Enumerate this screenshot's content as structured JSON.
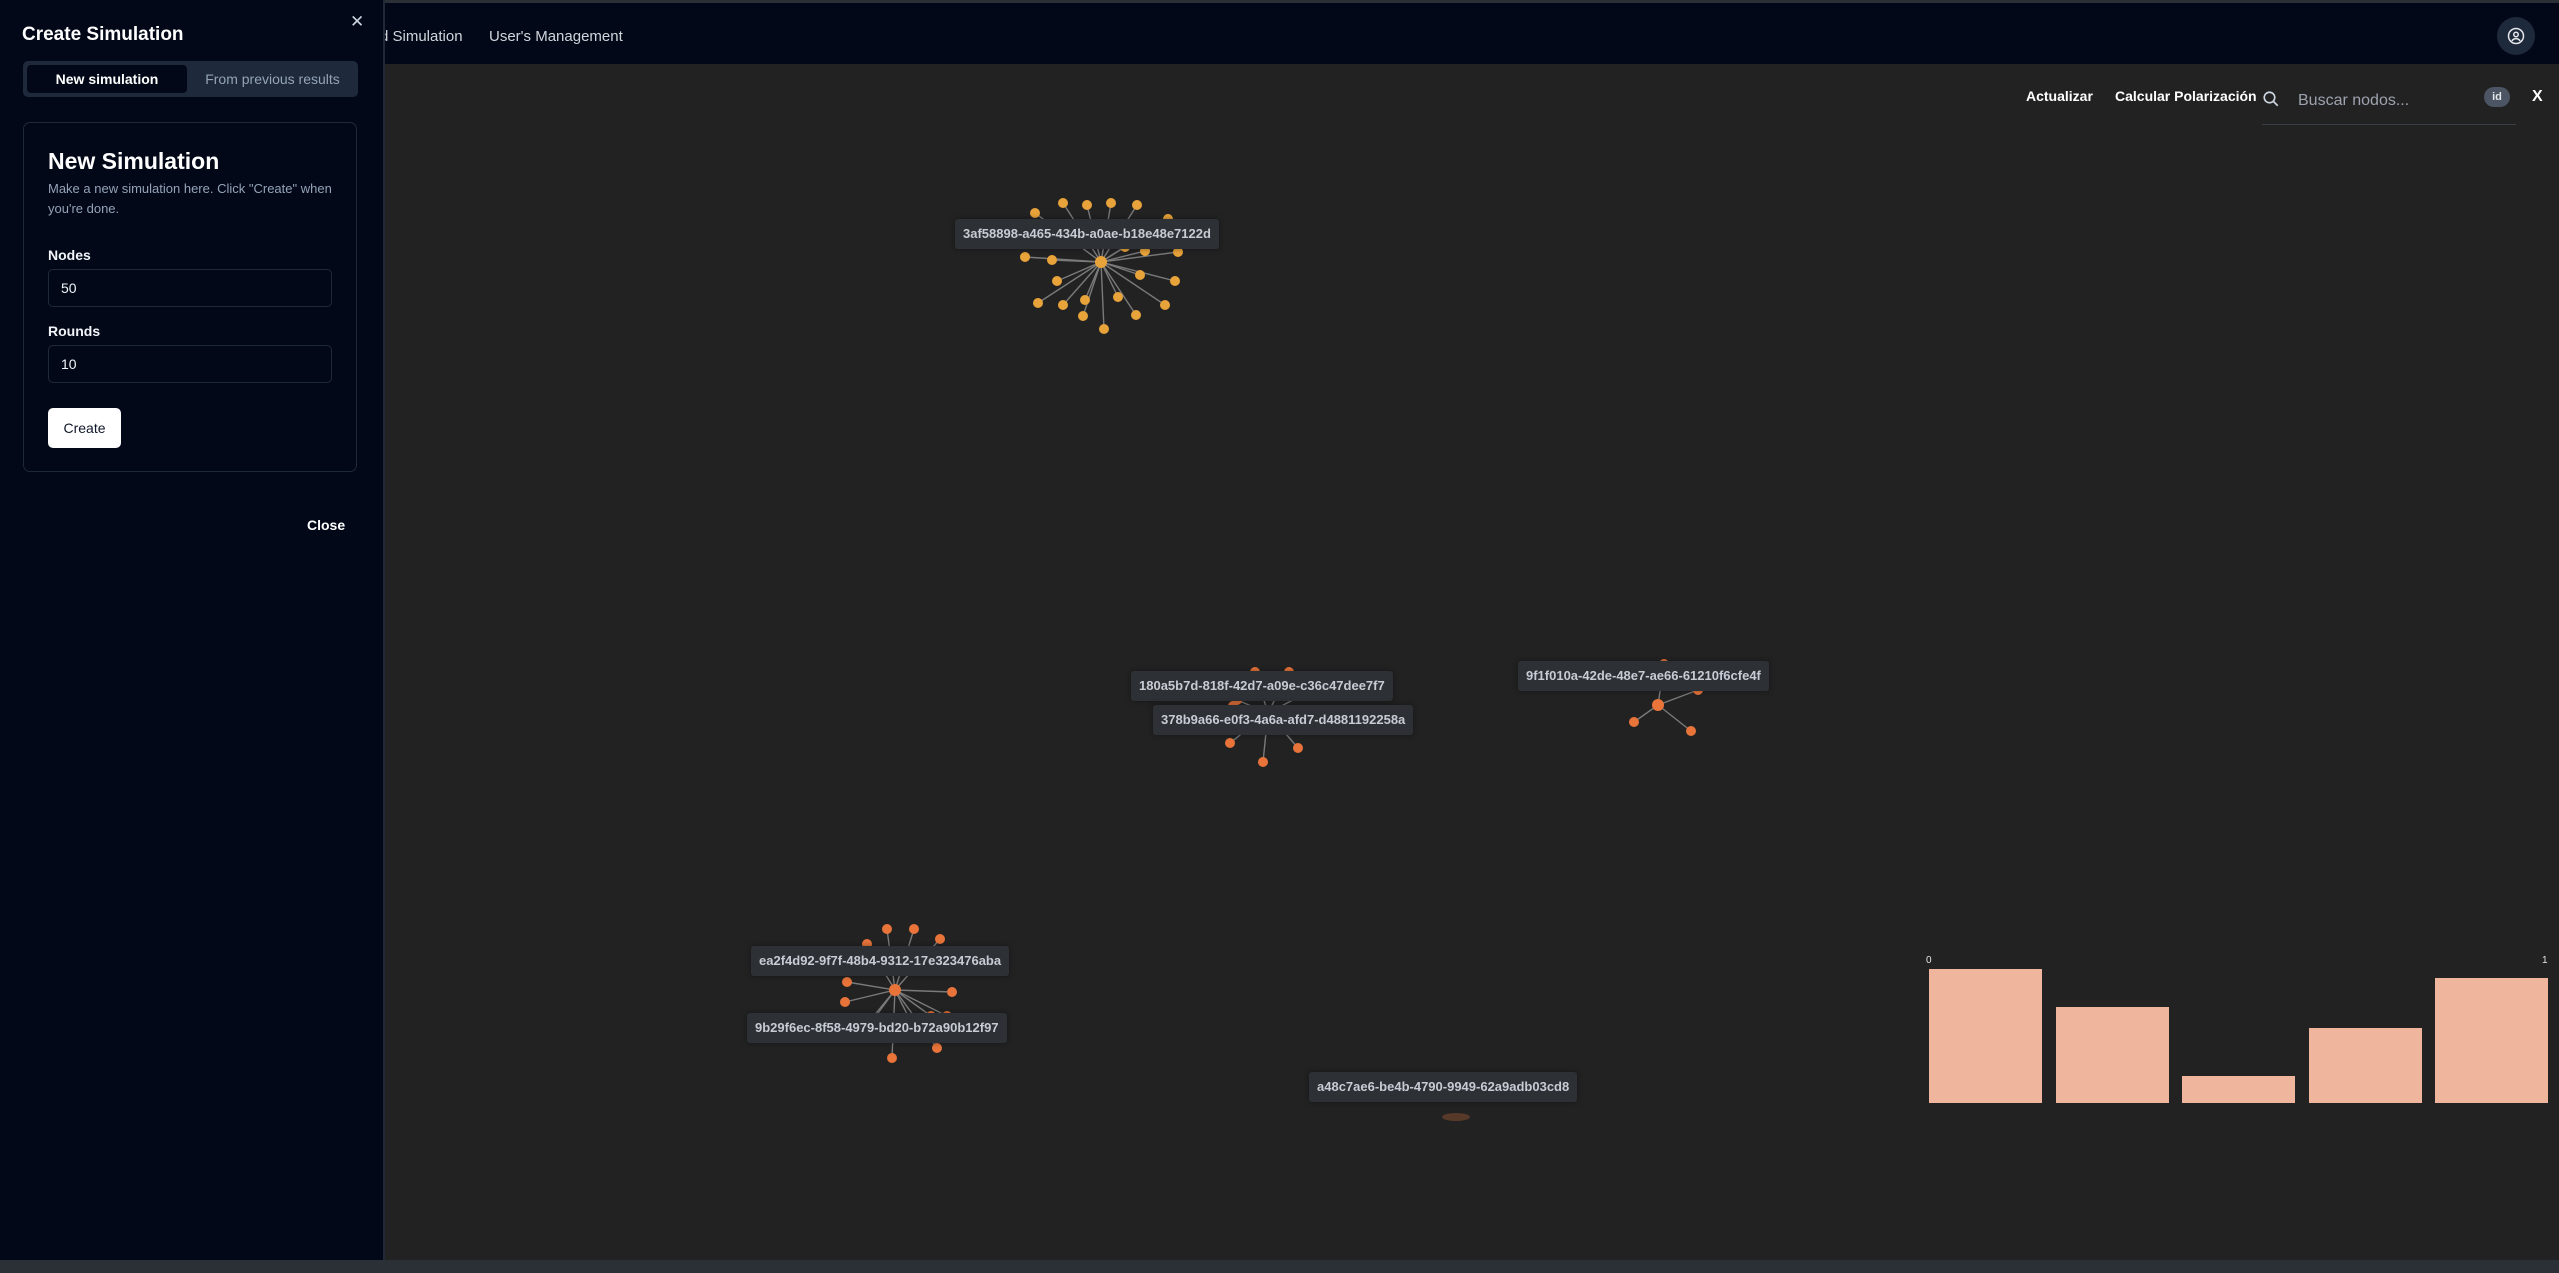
{
  "nav": {
    "items": [
      {
        "label": "d Simulation"
      },
      {
        "label": "User's Management"
      }
    ],
    "user_icon": "user-circle-icon"
  },
  "toolbar": {
    "refresh_label": "Actualizar",
    "polarization_label": "Calcular Polarización",
    "search_placeholder": "Buscar nodos...",
    "search_icon": "search-icon",
    "id_badge": "id",
    "close_label": "X"
  },
  "graph": {
    "labels": [
      "3af58898-a465-434b-a0ae-b18e48e7122d",
      "180a5b7d-818f-42d7-a09e-c36c47dee7f7",
      "378b9a66-e0f3-4a6a-afd7-d4881192258a",
      "9f1f010a-42de-48e7-ae66-61210f6cfe4f",
      "ea2f4d92-9f7f-48b4-9312-17e323476aba",
      "9b29f6ec-8f58-4979-bd20-b72a90b12f97",
      "a48c7ae6-be4b-4790-9949-62a9adb03cd8"
    ],
    "colors": {
      "yellow": "#e8a33a",
      "orange": "#e8743a",
      "edge": "#7a7a7a"
    }
  },
  "histogram": {
    "min_label": "0",
    "max_label": "1",
    "values": [
      1.0,
      0.72,
      0.2,
      0.56,
      0.93
    ],
    "color": "#efb69d"
  },
  "panel": {
    "title": "Create Simulation",
    "close_icon": "close-icon",
    "tabs": [
      {
        "label": "New simulation",
        "active": true
      },
      {
        "label": "From previous results",
        "active": false
      }
    ],
    "card": {
      "title": "New Simulation",
      "description": "Make a new simulation here. Click \"Create\" when you're done.",
      "nodes_label": "Nodes",
      "nodes_value": "50",
      "rounds_label": "Rounds",
      "rounds_value": "10",
      "create_label": "Create"
    },
    "close_label": "Close"
  }
}
